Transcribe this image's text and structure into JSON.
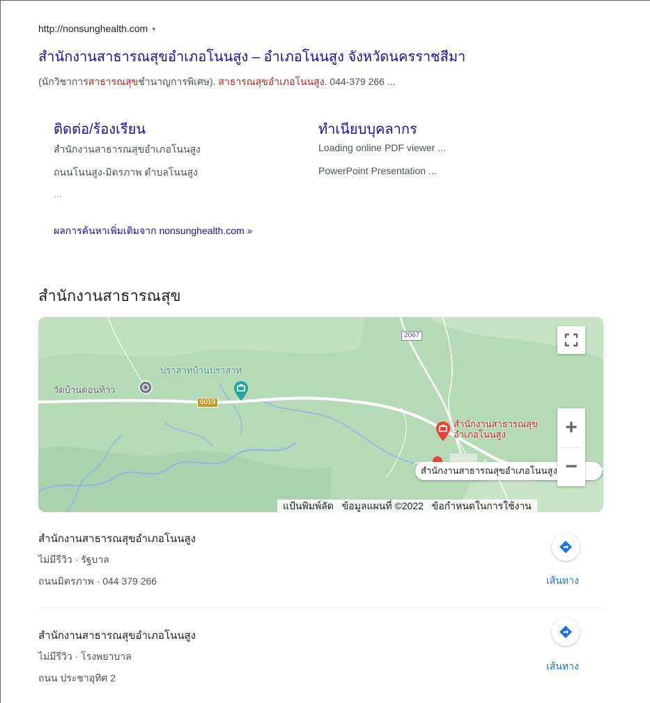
{
  "result": {
    "url": "http://nonsunghealth.com",
    "url_caret": "▾",
    "title": "สำนักงานสาธารณสุขอำเภอโนนสูง – อำเภอโนนสูง จังหวัดนครราชสีมา",
    "snippet": {
      "part1": "(นักวิชาการ",
      "hl1": "สาธารณสุข",
      "part2": "ชำนาญการพิเศษ). ",
      "hl2": "สาธารณสุขอำเภอโนนสูง",
      "part3": ". 044-379 266 ..."
    },
    "sublinks": [
      {
        "title": "ติดต่อ/ร้องเรียน",
        "lines": [
          "สำนักงานสาธารณสุขอำเภอโนนสูง",
          "ถนนโนนสูง-มิตรภาพ ตำบลโนนสูง",
          "..."
        ]
      },
      {
        "title": "ทำเนียบบุคลากร",
        "lines": [
          "Loading online PDF viewer ...",
          "PowerPoint Presentation ..."
        ]
      }
    ],
    "more_link": "ผลการค้นหาเพิ่มเติมจาก nonsunghealth.com »"
  },
  "local": {
    "heading": "สำนักงานสาธารณสุข",
    "map": {
      "labels": {
        "prasat": "ปราสาทบ้านปราสาท",
        "wat": "วัดบ้านดอนท้าว",
        "office_line1": "สำนักงานสาธารณสุข",
        "office_line2": "อำเภอโนนสูง"
      },
      "road_6019": "6019",
      "road_2067": "2067",
      "tooltip": "สำนักงานสาธารณสุขอำเภอโนนสูง",
      "attribution": {
        "shortcuts": "แป้นพิมพ์ลัด",
        "map_data": "ข้อมูลแผนที่ ©2022",
        "terms": "ข้อกำหนดในการใช้งาน"
      },
      "zoom_in": "+",
      "zoom_out": "−"
    },
    "places": [
      {
        "name": "สำนักงานสาธารณสุขอำเภอโนนสูง",
        "meta1": "ไม่มีรีวิว · รัฐบาล",
        "meta2": "ถนนมิตรภาพ · 044 379 266",
        "directions": "เส้นทาง"
      },
      {
        "name": "สำนักงานสาธารณสุขอำเภอโนนสูง",
        "meta1": "ไม่มีรีวิว · โรงพยาบาล",
        "meta2": "ถนน ประชาอุทิศ 2",
        "directions": "เส้นทาง"
      }
    ]
  },
  "colors": {
    "link": "#1a0dab",
    "highlight": "#c5221f",
    "directions_blue": "#1a73e8",
    "map_green": "#b9dcb9",
    "map_pin_red": "#ea4335",
    "map_pin_teal": "#26a69a"
  }
}
